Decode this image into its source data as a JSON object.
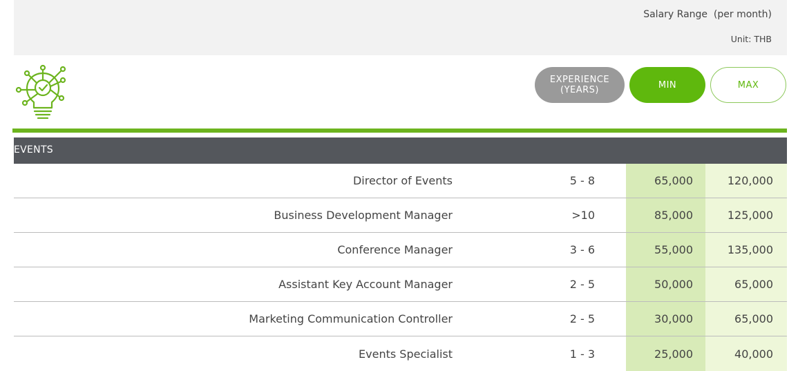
{
  "header": {
    "salary_range": "Salary Range  (per month)",
    "unit": "Unit: THB"
  },
  "icon": {
    "name": "lightbulb-check-icon",
    "color": "#6cb41e"
  },
  "pills": {
    "experience_line1": "EXPERIENCE",
    "experience_line2": "(YEARS)",
    "min": "MIN",
    "max": "MAX"
  },
  "colors": {
    "accent_green": "#6cb41e",
    "section_bg": "#54575c",
    "min_col_bg": "#d8ebb8",
    "max_col_bg": "#eef7d9",
    "exp_pill_bg": "#9a9a9a"
  },
  "section": {
    "title": "EVENTS"
  },
  "rows": [
    {
      "title": "Director of Events",
      "experience": "5 - 8",
      "min": "65,000",
      "max": "120,000"
    },
    {
      "title": "Business Development Manager",
      "experience": ">10",
      "min": "85,000",
      "max": "125,000"
    },
    {
      "title": "Conference Manager",
      "experience": "3 - 6",
      "min": "55,000",
      "max": "135,000"
    },
    {
      "title": "Assistant Key Account Manager",
      "experience": "2 - 5",
      "min": "50,000",
      "max": "65,000"
    },
    {
      "title": "Marketing Communication Controller",
      "experience": "2 - 5",
      "min": "30,000",
      "max": "65,000"
    },
    {
      "title": "Events Specialist",
      "experience": "1 - 3",
      "min": "25,000",
      "max": "40,000"
    }
  ]
}
